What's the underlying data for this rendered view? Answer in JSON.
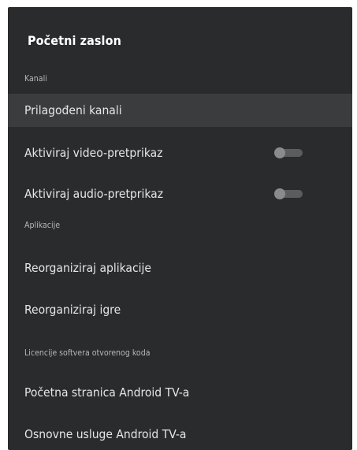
{
  "screen": {
    "title": "Početni zaslon",
    "sections": {
      "channels": "Kanali",
      "apps": "Aplikacije",
      "licenses": "Licencije softvera otvorenog koda"
    },
    "items": {
      "custom_channels": "Prilagođeni kanali",
      "video_preview": "Aktiviraj video-pretprikaz",
      "audio_preview": "Aktiviraj audio-pretprikaz",
      "reorder_apps": "Reorganiziraj aplikacije",
      "reorder_games": "Reorganiziraj igre",
      "android_tv_home": "Početna stranica Android TV-a",
      "android_tv_core": "Osnovne usluge Android TV-a"
    },
    "toggles": {
      "video_preview_enabled": false,
      "audio_preview_enabled": false
    }
  },
  "colors": {
    "panel_background": "#2a2b2d",
    "focused_row": "#3b3c3e",
    "toggle_track": "#5b5c5e",
    "toggle_thumb": "#8a8b8d"
  }
}
